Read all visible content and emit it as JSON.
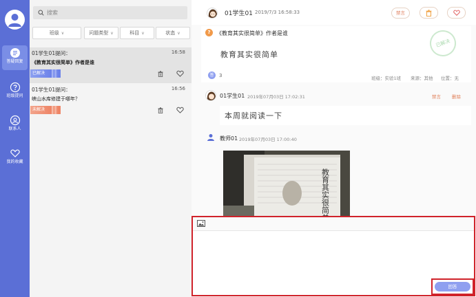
{
  "sidebar": {
    "items": [
      {
        "label": "答疑回复",
        "icon": "chat-icon"
      },
      {
        "label": "班级提问",
        "icon": "question-icon"
      },
      {
        "label": "联系人",
        "icon": "contacts-icon"
      },
      {
        "label": "我的收藏",
        "icon": "heart-icon"
      }
    ],
    "active_color": "#7a8ee6",
    "bg_color": "#5b6fd6"
  },
  "list": {
    "search_placeholder": "搜索",
    "filters": [
      "班级",
      "问题类型",
      "科目",
      "状态"
    ],
    "items": [
      {
        "asker": "01学生01提问：",
        "time": "16:58",
        "title": "《教育其实很简单》作者是谁",
        "status": "已解决",
        "status_color": "#6c82ea"
      },
      {
        "asker": "01学生01提问：",
        "time": "16:56",
        "title": "峡山水库修建于哪年？",
        "status": "未解决",
        "status_color": "#ee8566"
      }
    ]
  },
  "detail": {
    "user": "01学生01",
    "date": "2019/7/3 16:58:33",
    "ban_label": "禁言",
    "question_mark": "?",
    "question_title": "《教育其实很简单》作者是谁",
    "question_body": "教育其实很简单",
    "stamp": "已解决",
    "reply_count": "3",
    "meta_class": "班级：实验1班",
    "meta_source": "来源：其他",
    "meta_location": "位置：无",
    "replies": [
      {
        "user": "01学生01",
        "date": "2019年07月03日 17:02:31",
        "text": "本周就阅读一下",
        "ban": "禁言",
        "delete": "删除"
      },
      {
        "user": "教师01",
        "date": "2019年07月03日 17:00:40"
      }
    ],
    "photo_book_title": "教育其实很简单"
  },
  "editor": {
    "send_label": "回答",
    "image_tool_icon": "image-icon"
  }
}
